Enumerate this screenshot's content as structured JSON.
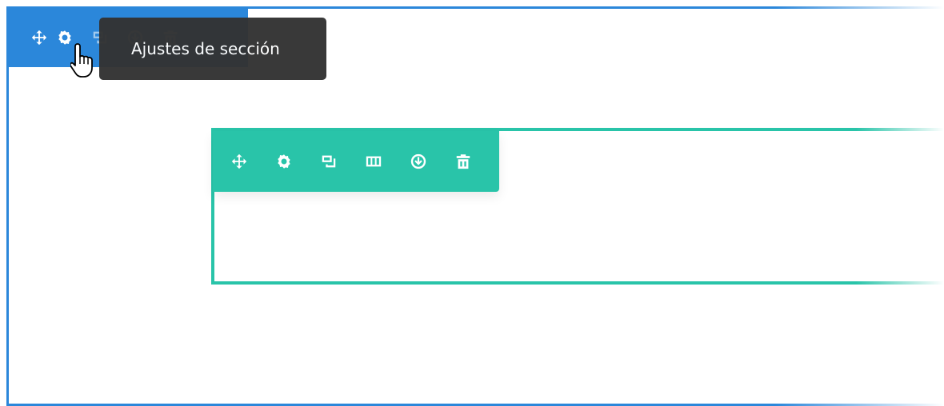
{
  "section": {
    "toolbar": {
      "color": "#2b87da",
      "buttons": [
        {
          "icon": "move-icon"
        },
        {
          "icon": "gear-icon"
        },
        {
          "icon": "duplicate-icon"
        },
        {
          "icon": "save-to-library-icon"
        },
        {
          "icon": "trash-icon"
        }
      ]
    },
    "tooltip": "Ajustes de sección"
  },
  "row": {
    "toolbar": {
      "color": "#29c4a9",
      "buttons": [
        {
          "icon": "move-icon"
        },
        {
          "icon": "gear-icon"
        },
        {
          "icon": "duplicate-icon"
        },
        {
          "icon": "columns-icon"
        },
        {
          "icon": "save-to-library-icon"
        },
        {
          "icon": "trash-icon"
        }
      ]
    }
  }
}
